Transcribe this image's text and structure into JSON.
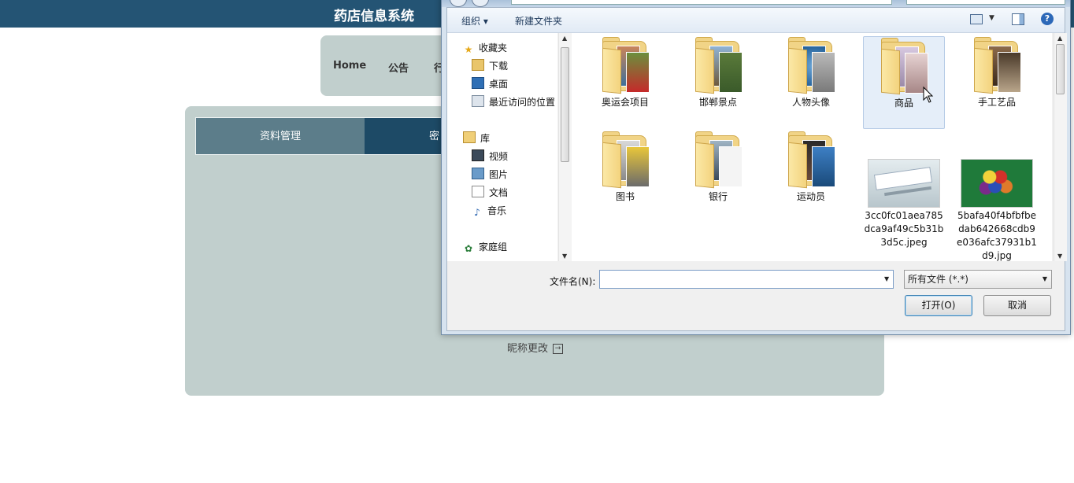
{
  "site": {
    "title": "药店信息系统",
    "nav": [
      "Home",
      "公告",
      "行"
    ]
  },
  "panel": {
    "tabs": [
      "资料管理",
      "密"
    ],
    "nickname_link": "昵称更改"
  },
  "dialog": {
    "toolbar": {
      "organize": "组织 ▾",
      "new_folder": "新建文件夹",
      "help": "?"
    },
    "nav_tree": {
      "favorites": "收藏夹",
      "fav_items": [
        "下载",
        "桌面",
        "最近访问的位置"
      ],
      "libraries": "库",
      "lib_items": [
        "视频",
        "图片",
        "文档",
        "音乐"
      ],
      "homegroup": "家庭组"
    },
    "items": [
      {
        "label": "奥运会项目",
        "kind": "folder"
      },
      {
        "label": "邯郸景点",
        "kind": "folder"
      },
      {
        "label": "人物头像",
        "kind": "folder"
      },
      {
        "label": "商品",
        "kind": "folder",
        "selected": true
      },
      {
        "label": "手工艺品",
        "kind": "folder"
      },
      {
        "label": "图书",
        "kind": "folder"
      },
      {
        "label": "银行",
        "kind": "folder"
      },
      {
        "label": "运动员",
        "kind": "folder"
      },
      {
        "label": "3cc0fc01aea785dca9af49c5b31b3d5c.jpeg",
        "kind": "image"
      },
      {
        "label": "5bafa40f4bfbfbedab642668cdb9e036afc37931b1d9.jpg",
        "kind": "image"
      }
    ],
    "filename_label": "文件名(N):",
    "filename_value": "",
    "filetype": "所有文件 (*.*)",
    "open_button": "打开(O)",
    "cancel_button": "取消"
  },
  "colors": {
    "header_bg": "#245474",
    "panel_bg": "#c1cfcd",
    "tab_active": "#1d4a66",
    "tab_inactive": "#5c7d8a"
  }
}
